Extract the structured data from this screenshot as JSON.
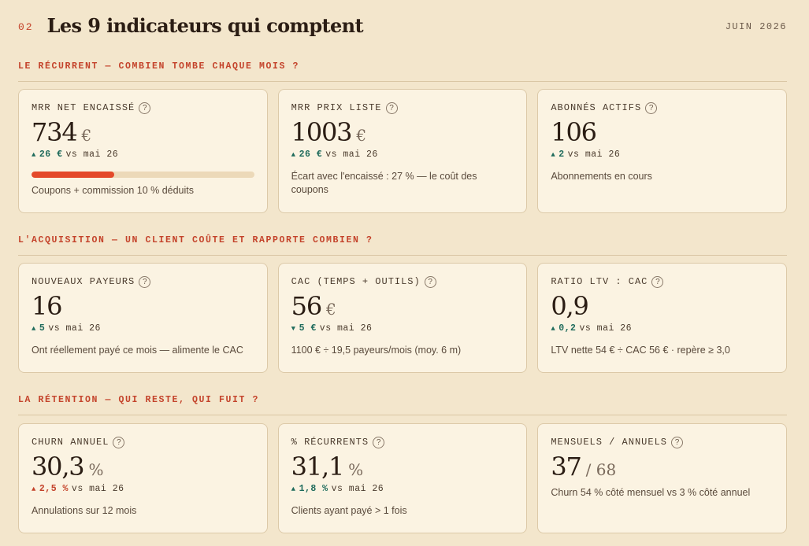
{
  "header": {
    "section_number": "02",
    "title": "Les 9 indicateurs qui comptent",
    "period": "JUIN 2026"
  },
  "colors": {
    "accent": "#c4432b",
    "positive": "#1f6b5c",
    "background": "#f3e6cc",
    "card": "#fbf3e2"
  },
  "sections": [
    {
      "title": "LE RÉCURRENT — COMBIEN TOMBE CHAQUE MOIS ?",
      "cards": [
        {
          "label": "MRR NET ENCAISSÉ",
          "value": "734",
          "unit": "€",
          "arrow": "▲",
          "delta": "26 €",
          "delta_tone": "good",
          "compare": "vs mai 26",
          "progress": 0.37,
          "note": "Coupons + commission 10 % déduits"
        },
        {
          "label": "MRR PRIX LISTE",
          "value": "1003",
          "unit": "€",
          "arrow": "▲",
          "delta": "26 €",
          "delta_tone": "good",
          "compare": "vs mai 26",
          "note": "Écart avec l'encaissé : 27 % — le coût des coupons"
        },
        {
          "label": "ABONNÉS ACTIFS",
          "value": "106",
          "unit": "",
          "arrow": "▲",
          "delta": "2",
          "delta_tone": "good",
          "compare": "vs mai 26",
          "note": "Abonnements en cours"
        }
      ]
    },
    {
      "title": "L'ACQUISITION — UN CLIENT COÛTE ET RAPPORTE COMBIEN ?",
      "cards": [
        {
          "label": "NOUVEAUX PAYEURS",
          "value": "16",
          "unit": "",
          "arrow": "▲",
          "delta": "5",
          "delta_tone": "good",
          "compare": "vs mai 26",
          "note": "Ont réellement payé ce mois — alimente le CAC"
        },
        {
          "label": "CAC (TEMPS + OUTILS)",
          "value": "56",
          "unit": "€",
          "arrow": "▼",
          "delta": "5 €",
          "delta_tone": "good",
          "compare": "vs mai 26",
          "note": "1100 € ÷ 19,5 payeurs/mois (moy. 6 m)"
        },
        {
          "label": "RATIO LTV : CAC",
          "value": "0,9",
          "unit": "",
          "arrow": "▲",
          "delta": "0,2",
          "delta_tone": "good",
          "compare": "vs mai 26",
          "note": "LTV nette 54 € ÷ CAC 56 € · repère ≥ 3,0"
        }
      ]
    },
    {
      "title": "LA RÉTENTION — QUI RESTE, QUI FUIT ?",
      "cards": [
        {
          "label": "CHURN ANNUEL",
          "value": "30,3",
          "unit": "%",
          "arrow": "▲",
          "delta": "2,5 %",
          "delta_tone": "bad",
          "compare": "vs mai 26",
          "note": "Annulations sur 12 mois"
        },
        {
          "label": "% RÉCURRENTS",
          "value": "31,1",
          "unit": "%",
          "arrow": "▲",
          "delta": "1,8 %",
          "delta_tone": "good",
          "compare": "vs mai 26",
          "note": "Clients ayant payé > 1 fois"
        },
        {
          "label": "MENSUELS / ANNUELS",
          "value": "37",
          "unit": "/ 68",
          "note": "Churn 54 % côté mensuel vs 3 % côté annuel"
        }
      ]
    }
  ]
}
